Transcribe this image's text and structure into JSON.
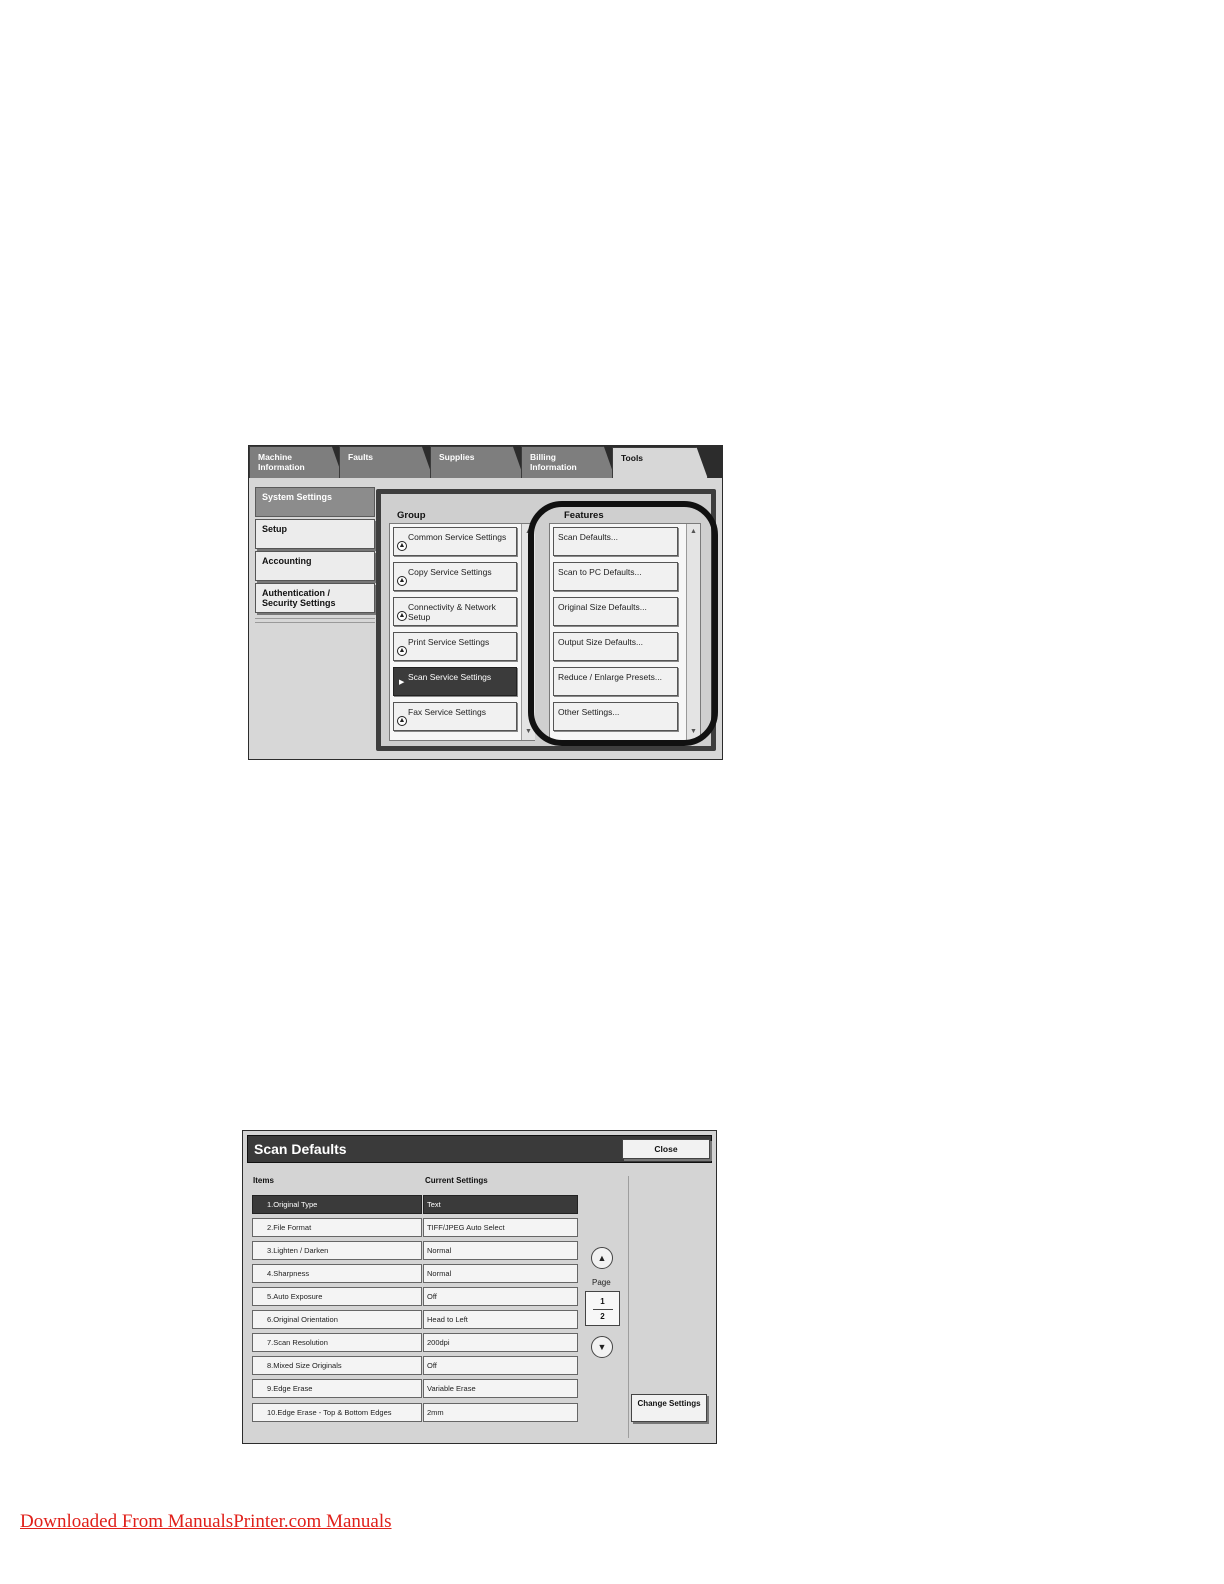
{
  "tools_screen": {
    "tabs": [
      {
        "label": "Machine\nInformation",
        "active": false
      },
      {
        "label": "Faults",
        "active": false
      },
      {
        "label": "Supplies",
        "active": false
      },
      {
        "label": "Billing\nInformation",
        "active": false
      },
      {
        "label": "Tools",
        "active": true
      }
    ],
    "sidebar": [
      {
        "label": "System Settings",
        "active": true
      },
      {
        "label": "Setup",
        "active": false
      },
      {
        "label": "Accounting",
        "active": false
      },
      {
        "label": "Authentication /\nSecurity Settings",
        "active": false
      }
    ],
    "group_heading": "Group",
    "features_heading": "Features",
    "groups": [
      {
        "label": "Common Service Settings",
        "selected": false
      },
      {
        "label": "Copy Service Settings",
        "selected": false
      },
      {
        "label": "Connectivity & Network Setup",
        "selected": false
      },
      {
        "label": "Print Service Settings",
        "selected": false
      },
      {
        "label": "Scan Service Settings",
        "selected": true
      },
      {
        "label": "Fax Service Settings",
        "selected": false
      }
    ],
    "features": [
      "Scan Defaults...",
      "Scan to PC Defaults...",
      "Original Size Defaults...",
      "Output Size Defaults...",
      "Reduce / Enlarge Presets...",
      "Other Settings..."
    ]
  },
  "scan_defaults": {
    "title": "Scan Defaults",
    "close_label": "Close",
    "col_items": "Items",
    "col_current": "Current Settings",
    "rows": [
      {
        "item": "1.Original Type",
        "value": "Text",
        "selected": true
      },
      {
        "item": "2.File Format",
        "value": "TIFF/JPEG Auto Select",
        "selected": false
      },
      {
        "item": "3.Lighten / Darken",
        "value": "Normal",
        "selected": false
      },
      {
        "item": "4.Sharpness",
        "value": "Normal",
        "selected": false
      },
      {
        "item": "5.Auto Exposure",
        "value": "Off",
        "selected": false
      },
      {
        "item": "6.Original Orientation",
        "value": "Head to Left",
        "selected": false
      },
      {
        "item": "7.Scan Resolution",
        "value": "200dpi",
        "selected": false
      },
      {
        "item": "8.Mixed Size Originals",
        "value": "Off",
        "selected": false
      },
      {
        "item": "9.Edge Erase",
        "value": "Variable Erase",
        "selected": false
      },
      {
        "item": "10.Edge Erase - Top & Bottom Edges",
        "value": "2mm",
        "selected": false
      }
    ],
    "page_label": "Page",
    "page_current": "1",
    "page_total": "2",
    "change_settings_label": "Change Settings"
  },
  "footer": {
    "link_text": "Downloaded From ManualsPrinter.com Manuals",
    "link_color": "#e0201a"
  }
}
